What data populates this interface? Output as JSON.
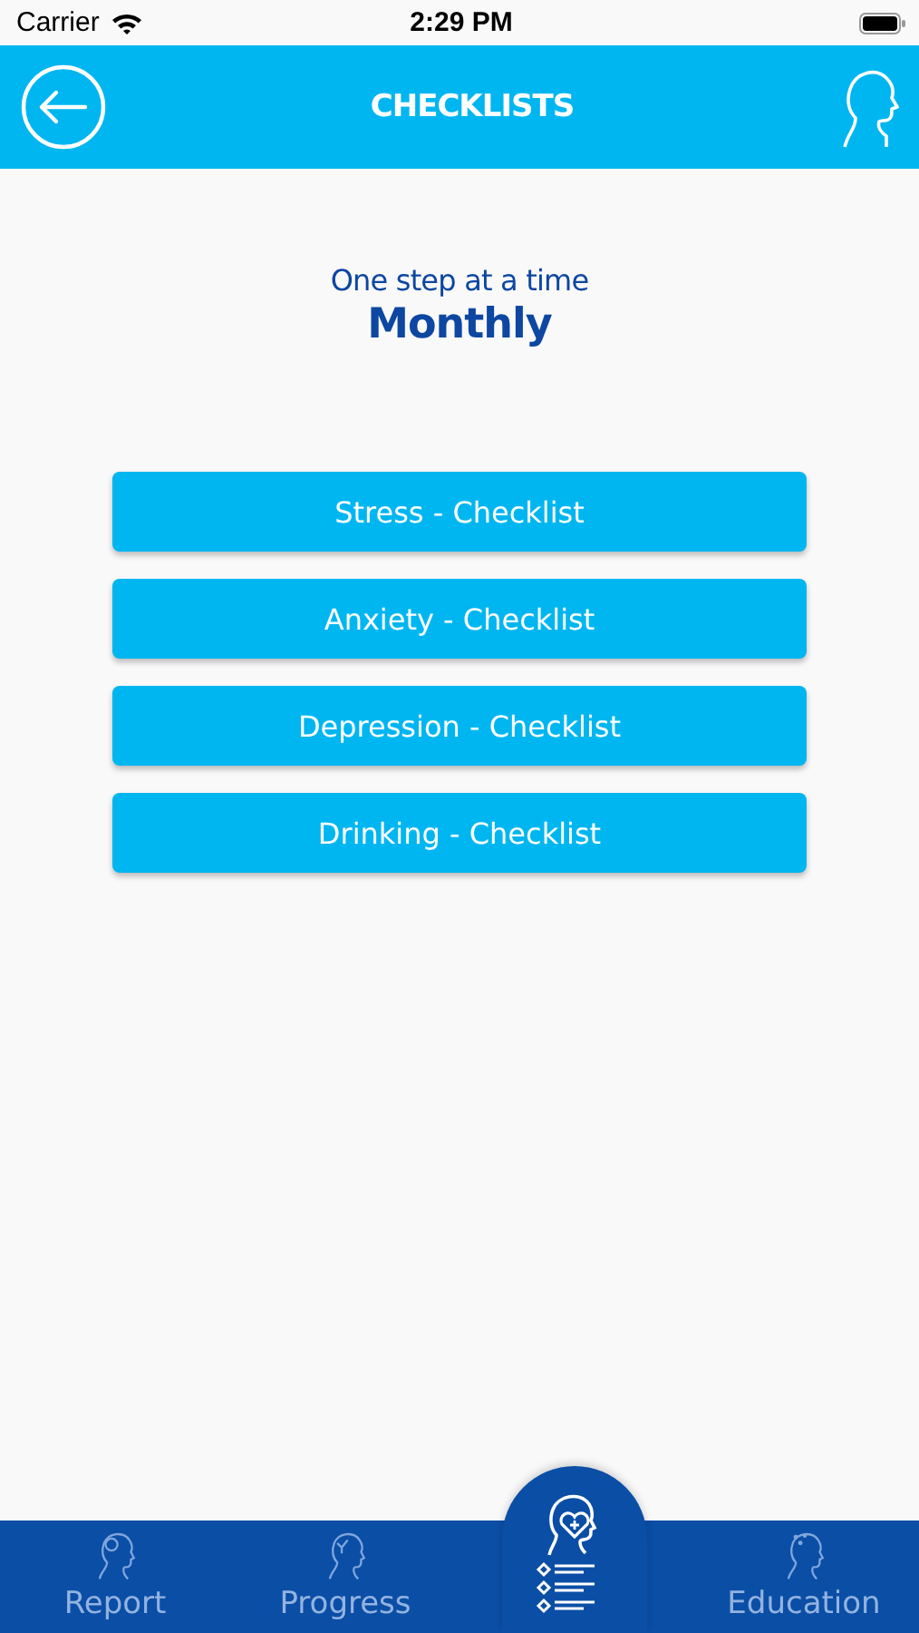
{
  "status_bar": {
    "carrier": "Carrier",
    "time": "2:29 PM"
  },
  "header": {
    "title": "CHECKLISTS"
  },
  "intro": {
    "subtitle": "One step at a time",
    "period": "Monthly"
  },
  "checklists": [
    {
      "label": "Stress - Checklist"
    },
    {
      "label": "Anxiety - Checklist"
    },
    {
      "label": "Depression - Checklist"
    },
    {
      "label": "Drinking - Checklist"
    }
  ],
  "tab_bar": [
    {
      "kind": "report",
      "label": "Report",
      "selected": false
    },
    {
      "kind": "progress",
      "label": "Progress",
      "selected": false
    },
    {
      "kind": "checklists",
      "selected": true
    },
    {
      "kind": "education",
      "label": "Education",
      "selected": false
    }
  ]
}
